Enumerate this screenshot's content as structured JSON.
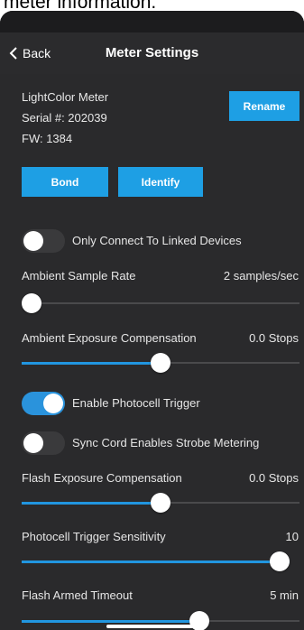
{
  "caption": "meter information.",
  "header": {
    "back_label": "Back",
    "title": "Meter Settings"
  },
  "device": {
    "name": "LightColor Meter",
    "serial": "Serial #: 202039",
    "firmware": "FW: 1384"
  },
  "buttons": {
    "rename": "Rename",
    "bond": "Bond",
    "identify": "Identify"
  },
  "toggles": {
    "linked_only": {
      "label": "Only Connect To Linked Devices",
      "on": false
    },
    "photocell": {
      "label": "Enable Photocell Trigger",
      "on": true
    },
    "sync_cord": {
      "label": "Sync Cord Enables Strobe Metering",
      "on": false
    }
  },
  "sliders": {
    "ambient_rate": {
      "label": "Ambient Sample Rate",
      "value": "2 samples/sec",
      "fraction": 0.0
    },
    "ambient_comp": {
      "label": "Ambient Exposure Compensation",
      "value": "0.0 Stops",
      "fraction": 0.5
    },
    "flash_comp": {
      "label": "Flash Exposure Compensation",
      "value": "0.0 Stops",
      "fraction": 0.5
    },
    "photocell_sens": {
      "label": "Photocell Trigger Sensitivity",
      "value": "10",
      "fraction": 1.0
    },
    "flash_timeout": {
      "label": "Flash Armed Timeout",
      "value": "5 min",
      "fraction": 0.65
    }
  },
  "colors": {
    "accent": "#1e9fe4",
    "background": "#2a2a2c",
    "header": "#2b2b2d"
  }
}
